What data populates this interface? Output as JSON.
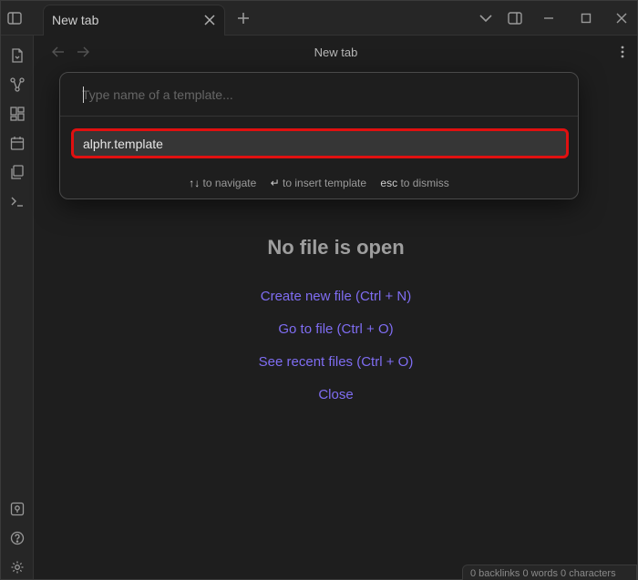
{
  "tabbar": {
    "tab_label": "New tab",
    "icons": {
      "sidebar_toggle": "sidebar-left-icon",
      "close": "close-icon",
      "new_tab": "plus-icon",
      "tab_list": "chevron-down-icon",
      "right_sidebar": "sidebar-right-icon",
      "minimize": "minimize-icon",
      "maximize": "maximize-icon",
      "window_close": "close-icon"
    }
  },
  "ribbon": {
    "items": [
      "file-icon",
      "graph-icon",
      "canvas-icon",
      "calendar-icon",
      "templates-icon",
      "terminal-icon"
    ],
    "bottom": [
      "vault-icon",
      "help-icon",
      "settings-icon"
    ]
  },
  "view": {
    "title": "New tab",
    "empty_title": "No file is open",
    "links": [
      "Create new file (Ctrl + N)",
      "Go to file (Ctrl + O)",
      "See recent files (Ctrl + O)",
      "Close"
    ]
  },
  "modal": {
    "placeholder": "Type name of a template...",
    "value": "",
    "suggestion": "alphr.template",
    "footer": {
      "navigate_key": "↑↓",
      "navigate_text": "to navigate",
      "insert_key": "↵",
      "insert_text": "to insert template",
      "dismiss_key": "esc",
      "dismiss_text": "to dismiss"
    }
  },
  "status": {
    "text": "0 backlinks   0 words   0 characters"
  },
  "colors": {
    "accent": "#7f6df2",
    "highlight_border": "#e01010",
    "background": "#1e1e1e"
  }
}
